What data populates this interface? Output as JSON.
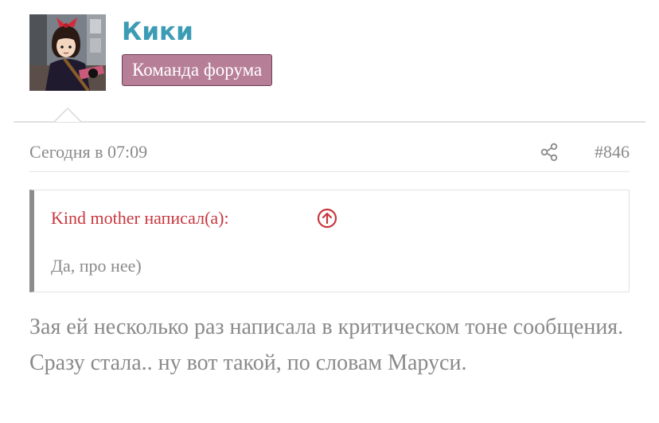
{
  "post": {
    "author": "Кики",
    "role": "Команда форума",
    "date": "Сегодня в 07:09",
    "number": "#846",
    "quote": {
      "header": "Kind mother написал(а):",
      "text": "Да, про нее)"
    },
    "message": "Зая ей несколько раз написала в критическом тоне сообщения. Сразу стала.. ну вот такой, по словам Маруси."
  },
  "icons": {
    "share": "share-icon",
    "jump_to_quote": "arrow-up-circle-icon"
  },
  "colors": {
    "username": "#3d9cb5",
    "role_badge_bg": "#b77e98",
    "quote_header": "#c8373e",
    "muted_text": "#8a8a8a"
  }
}
